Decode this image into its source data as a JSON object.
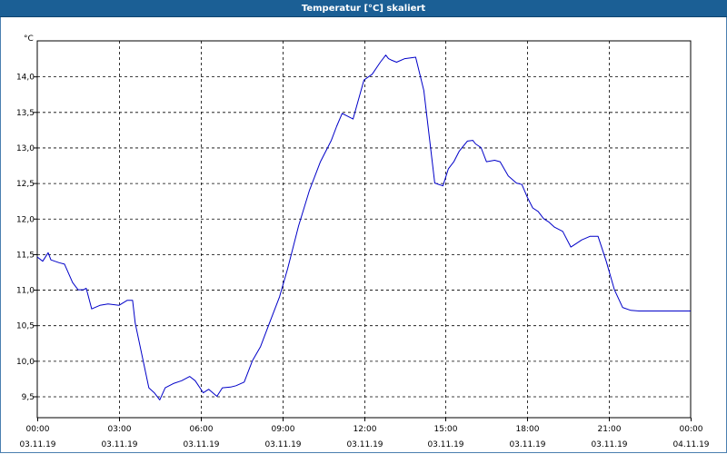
{
  "window": {
    "title": "Temperatur [°C] skaliert"
  },
  "colors": {
    "titlebar": "#1b5f95",
    "series": "#0000c8",
    "grid": "#000000",
    "background": "#ffffff"
  },
  "chart_data": {
    "type": "line",
    "title": "Temperatur [°C] skaliert",
    "ylabel": "°C",
    "ylim": [
      9.2,
      14.5
    ],
    "yticks": [
      9.5,
      10.0,
      10.5,
      11.0,
      11.5,
      12.0,
      12.5,
      13.0,
      13.5,
      14.0
    ],
    "ytick_labels": [
      "9,5",
      "10,0",
      "10,5",
      "11,0",
      "11,5",
      "12,0",
      "12,5",
      "13,0",
      "13,5",
      "14,0"
    ],
    "xlim": [
      0,
      24
    ],
    "xticks": [
      0,
      3,
      6,
      9,
      12,
      15,
      18,
      21,
      24
    ],
    "xtick_labels": [
      [
        "00:00",
        "03.11.19"
      ],
      [
        "03:00",
        "03.11.19"
      ],
      [
        "06:00",
        "03.11.19"
      ],
      [
        "09:00",
        "03.11.19"
      ],
      [
        "12:00",
        "03.11.19"
      ],
      [
        "15:00",
        "03.11.19"
      ],
      [
        "18:00",
        "03.11.19"
      ],
      [
        "21:00",
        "03.11.19"
      ],
      [
        "00:00",
        "04.11.19"
      ]
    ],
    "grid": true,
    "series": [
      {
        "x": [
          0,
          0.2,
          0.4,
          0.5,
          0.8,
          1.0,
          1.3,
          1.5,
          1.7,
          1.8,
          2.0,
          2.3,
          2.6,
          3.0,
          3.3,
          3.5,
          3.6,
          4.1,
          4.3,
          4.5,
          4.7,
          5.0,
          5.3,
          5.6,
          5.8,
          6.1,
          6.3,
          6.6,
          6.8,
          7.1,
          7.3,
          7.6,
          7.9,
          8.2,
          8.5,
          8.9,
          9.2,
          9.6,
          10.0,
          10.4,
          10.8,
          11.0,
          11.2,
          11.6,
          12.0,
          12.3,
          12.6,
          12.8,
          12.9,
          13.0,
          13.2,
          13.5,
          13.9,
          14.2,
          14.6,
          14.9,
          15.1,
          15.3,
          15.5,
          15.8,
          16.0,
          16.1,
          16.3,
          16.5,
          16.8,
          17.0,
          17.3,
          17.6,
          17.8,
          18.0,
          18.2,
          18.4,
          18.6,
          18.8,
          19.0,
          19.3,
          19.6,
          20.0,
          20.3,
          20.6,
          20.9,
          21.2,
          21.5,
          21.8,
          22.1,
          22.4,
          22.7,
          22.9,
          23.1,
          23.3,
          23.6,
          24.0
        ],
        "y": [
          11.46,
          11.4,
          11.52,
          11.42,
          11.38,
          11.36,
          11.1,
          11.0,
          11.0,
          11.02,
          10.73,
          10.78,
          10.8,
          10.78,
          10.85,
          10.85,
          10.53,
          9.62,
          9.55,
          9.45,
          9.62,
          9.68,
          9.72,
          9.78,
          9.72,
          9.55,
          9.6,
          9.5,
          9.62,
          9.63,
          9.65,
          9.7,
          10.0,
          10.2,
          10.5,
          10.9,
          11.3,
          11.9,
          12.4,
          12.8,
          13.1,
          13.3,
          13.48,
          13.4,
          13.95,
          14.03,
          14.2,
          14.3,
          14.25,
          14.23,
          14.2,
          14.25,
          14.27,
          13.8,
          12.5,
          12.46,
          12.7,
          12.8,
          12.95,
          13.09,
          13.1,
          13.05,
          13.0,
          12.8,
          12.82,
          12.8,
          12.6,
          12.5,
          12.48,
          12.3,
          12.15,
          12.1,
          12.0,
          11.95,
          11.88,
          11.82,
          11.6,
          11.7,
          11.75,
          11.75,
          11.4,
          11.0,
          10.75,
          10.71,
          10.7,
          10.7,
          10.7,
          10.7,
          10.7,
          10.7,
          10.7,
          10.7
        ]
      }
    ]
  }
}
